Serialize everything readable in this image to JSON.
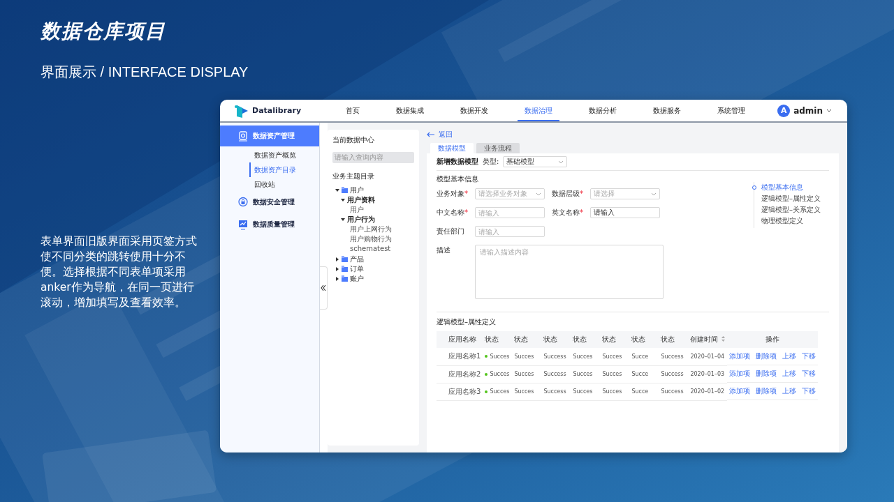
{
  "slide": {
    "title": "数据仓库项目",
    "subtitle": "界面展示 / INTERFACE DISPLAY",
    "description": "表单界面旧版界面采用页签方式使不同分类的跳转使用十分不便。选择根据不同表单项采用anker作为导航，在同一页进行滚动，增加填写及查看效率。"
  },
  "app": {
    "logo_text": "Datalibrary",
    "nav": [
      {
        "label": "首页",
        "selected": false
      },
      {
        "label": "数据集成",
        "selected": false
      },
      {
        "label": "数据开发",
        "selected": false
      },
      {
        "label": "数据治理",
        "selected": true
      },
      {
        "label": "数据分析",
        "selected": false
      },
      {
        "label": "数据服务",
        "selected": false
      },
      {
        "label": "系统管理",
        "selected": false
      }
    ],
    "user": {
      "avatar_letter": "A",
      "name": "admin"
    },
    "sidebar": {
      "menus": [
        {
          "label": "数据资产管理",
          "kind": "asset",
          "selected": true,
          "children": [
            {
              "label": "数据资产概览",
              "selected": false
            },
            {
              "label": "数据资产目录",
              "selected": true
            },
            {
              "label": "回收站",
              "selected": false
            }
          ]
        },
        {
          "label": "数据安全管理",
          "kind": "security",
          "selected": false
        },
        {
          "label": "数据质量管理",
          "kind": "quality",
          "selected": false
        }
      ]
    },
    "tree_panel": {
      "title": "当前数据中心",
      "search": {
        "placeholder": "请输入查询内容"
      },
      "section_title": "业务主题目录",
      "tree": [
        {
          "label": "用户",
          "kind": "folder",
          "expanded": true,
          "children": [
            {
              "label": "用户资料",
              "kind": "group",
              "expanded": true,
              "children": [
                {
                  "label": "用户",
                  "kind": "leaf"
                }
              ]
            },
            {
              "label": "用户行为",
              "kind": "group",
              "expanded": true,
              "children": [
                {
                  "label": "用户上网行为",
                  "kind": "leaf"
                },
                {
                  "label": "用户购物行为",
                  "kind": "leaf"
                },
                {
                  "label": "schematest",
                  "kind": "leaf"
                }
              ]
            }
          ]
        },
        {
          "label": "产品",
          "kind": "folder",
          "expanded": false
        },
        {
          "label": "订单",
          "kind": "folder",
          "expanded": false
        },
        {
          "label": "账户",
          "kind": "folder",
          "expanded": false
        }
      ]
    },
    "content": {
      "back": "返回",
      "tabs": [
        {
          "label": "数据模型",
          "selected": true
        },
        {
          "label": "业务流程",
          "selected": false
        }
      ],
      "form_title": "新增数据模型",
      "type_label": "类型:",
      "type_value": "基础模型",
      "section_title": "模型基本信息",
      "fields": [
        {
          "label": "业务对象",
          "required_mark": "*",
          "kind": "select",
          "placeholder": "请选择业务对象"
        },
        {
          "label": "数据层级",
          "required_mark": "*",
          "kind": "select",
          "placeholder": "请选择"
        },
        {
          "label": "中文名称",
          "required_mark": "*",
          "kind": "input",
          "placeholder": "请输入"
        },
        {
          "label": "英文名称",
          "required_mark": "*",
          "kind": "input",
          "value": "请输入"
        },
        {
          "label": "责任部门",
          "kind": "input",
          "placeholder": "请输入"
        },
        {
          "label": "描述",
          "kind": "textarea",
          "placeholder": "请输入描述内容"
        }
      ],
      "anchors": [
        {
          "label": "模型基本信息",
          "selected": true
        },
        {
          "label": "逻辑模型–属性定义",
          "selected": false
        },
        {
          "label": "逻辑模型–关系定义",
          "selected": false
        },
        {
          "label": "物理模型定义",
          "selected": false
        }
      ],
      "table": {
        "title": "逻辑模型–属性定义",
        "columns": [
          {
            "label": "应用名称"
          },
          {
            "label": "状态"
          },
          {
            "label": "状态"
          },
          {
            "label": "状态"
          },
          {
            "label": "状态"
          },
          {
            "label": "状态"
          },
          {
            "label": "状态"
          },
          {
            "label": "状态"
          },
          {
            "label": "创建时间",
            "sortable": true
          },
          {
            "label": "操作"
          }
        ],
        "rows": [
          {
            "name": "应用名称1",
            "color": "#52c41a",
            "statuses": [
              "Succes",
              "Succes",
              "Success",
              "Succes",
              "Succes",
              "Succe",
              "Success"
            ],
            "created": "2020–01–04",
            "actions": [
              "添加项",
              "删除项",
              "上移",
              "下移"
            ]
          },
          {
            "name": "应用名称2",
            "color": "#52c41a",
            "statuses": [
              "Succes",
              "Succes",
              "Success",
              "Succes",
              "Succes",
              "Succe",
              "Success"
            ],
            "created": "2020–01–03",
            "actions": [
              "添加项",
              "删除项",
              "上移",
              "下移"
            ]
          },
          {
            "name": "应用名称3",
            "color": "#52c41a",
            "statuses": [
              "Succes",
              "Succes",
              "Success",
              "Succes",
              "Succes",
              "Succe",
              "Success"
            ],
            "created": "2020–01–02",
            "actions": [
              "添加项",
              "删除项",
              "上移",
              "下移"
            ]
          }
        ]
      }
    }
  }
}
